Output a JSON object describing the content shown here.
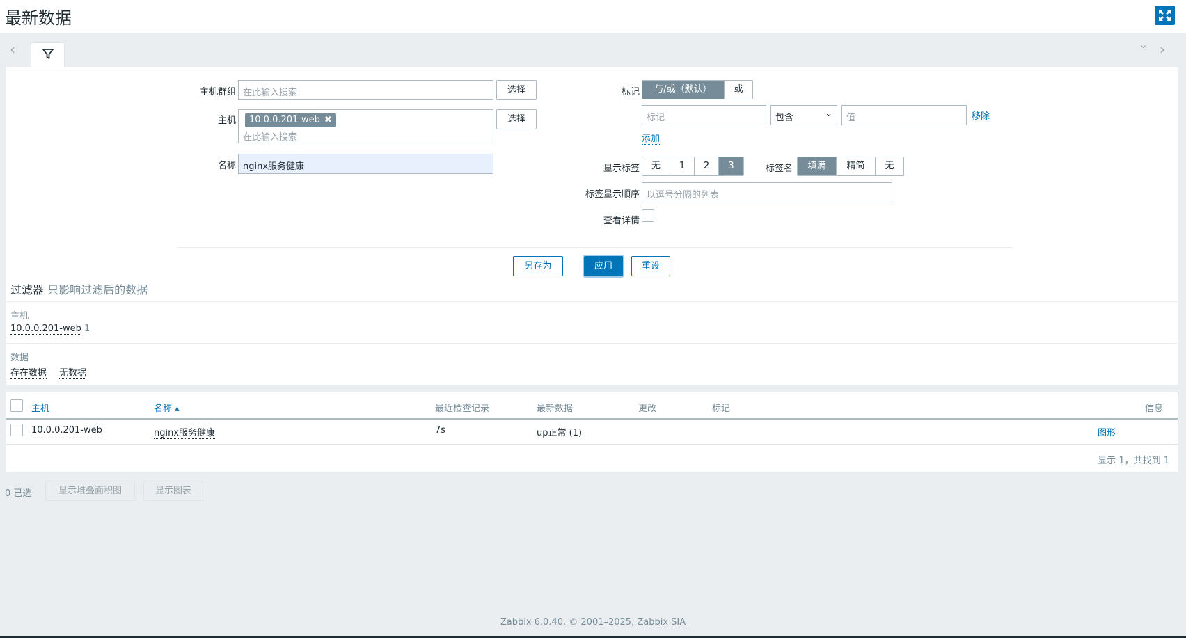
{
  "header": {
    "title": "最新数据"
  },
  "filter": {
    "hostgroup_label": "主机群组",
    "hostgroup_placeholder": "在此输入搜索",
    "select_label": "选择",
    "host_label": "主机",
    "host_chip": "10.0.0.201-web",
    "host_placeholder": "在此输入搜索",
    "name_label": "名称",
    "name_value": "nginx服务健康",
    "tags_label": "标记",
    "tags_mode": [
      "与/或（默认）",
      "或"
    ],
    "tag_placeholder": "标记",
    "tag_operator": "包含",
    "tag_value_placeholder": "值",
    "remove_label": "移除",
    "add_label": "添加",
    "show_tags_label": "显示标签",
    "show_tags_options": [
      "无",
      "1",
      "2",
      "3"
    ],
    "tag_name_label": "标签名",
    "tag_name_options": [
      "填满",
      "精简",
      "无"
    ],
    "tag_priority_label": "标签显示顺序",
    "tag_priority_placeholder": "以逗号分隔的列表",
    "show_details_label": "查看详情",
    "save_as_label": "另存为",
    "apply_label": "应用",
    "reset_label": "重设"
  },
  "subfilter": {
    "title": "过滤器",
    "subtitle": "只影响过滤后的数据",
    "hosts_heading": "主机",
    "host_item": "10.0.0.201-web",
    "host_count": "1",
    "data_heading": "数据",
    "data_with": "存在数据",
    "data_without": "无数据"
  },
  "table": {
    "headers": {
      "host": "主机",
      "name": "名称 ▴",
      "last_check": "最近检查记录",
      "last_value": "最新数据",
      "change": "更改",
      "tags": "标记",
      "info": "信息"
    },
    "rows": [
      {
        "host": "10.0.0.201-web",
        "name": "nginx服务健康",
        "last_check": "7s",
        "last_value": "up正常 (1)",
        "change": "",
        "tags": "",
        "graph": "图形"
      }
    ],
    "paging": "显示 1，共找到 1"
  },
  "actions": {
    "selected": "0 已选",
    "stacked_graph": "显示堆叠面积图",
    "show_graph": "显示图表"
  },
  "footer": {
    "text": "Zabbix 6.0.40. © 2001–2025,",
    "company": "Zabbix SIA"
  },
  "colors": {
    "accent": "#0275b8",
    "segment_active": "#768d99",
    "background": "#ebeef0"
  }
}
